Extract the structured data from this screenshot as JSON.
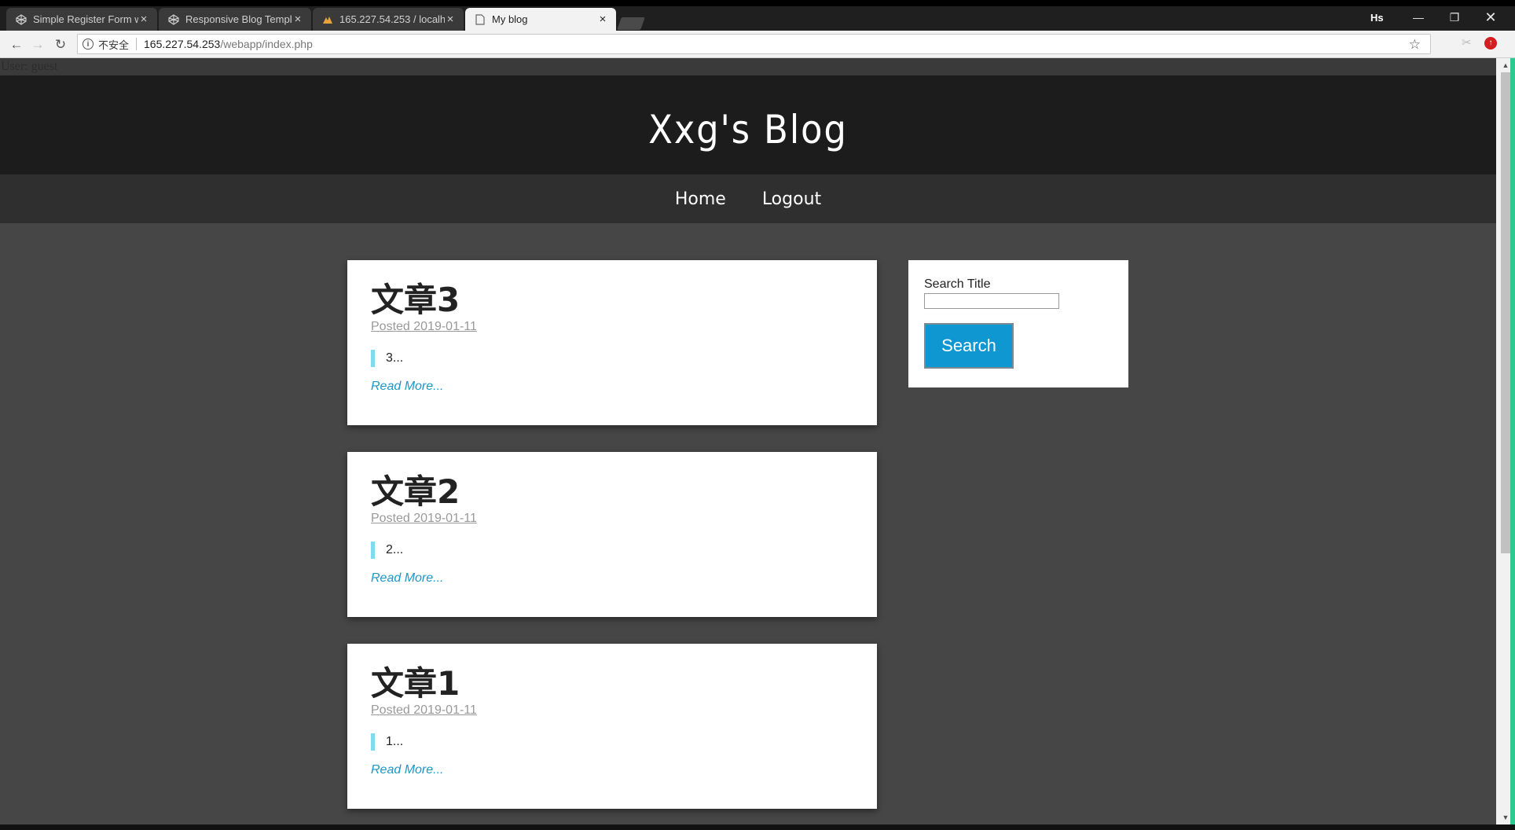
{
  "browser": {
    "tabs": [
      {
        "title": "Simple Register Form w",
        "icon": "codepen-icon"
      },
      {
        "title": "Responsive Blog Templ",
        "icon": "codepen-icon"
      },
      {
        "title": "165.227.54.253 / localh",
        "icon": "phpmyadmin-icon"
      },
      {
        "title": "My blog",
        "icon": "page-icon"
      }
    ],
    "profile": "Hs",
    "address": {
      "security_label": "不安全",
      "host": "165.227.54.253",
      "path": "/webapp/index.php"
    }
  },
  "page": {
    "user_line": "User: guest",
    "blog_title": "Xxg's Blog",
    "nav": [
      "Home",
      "Logout"
    ],
    "posts": [
      {
        "title": "文章3",
        "date": "Posted 2019-01-11",
        "excerpt": "3...",
        "more": "Read More..."
      },
      {
        "title": "文章2",
        "date": "Posted 2019-01-11",
        "excerpt": "2...",
        "more": "Read More..."
      },
      {
        "title": "文章1",
        "date": "Posted 2019-01-11",
        "excerpt": "1...",
        "more": "Read More..."
      }
    ],
    "sidebar": {
      "search_label": "Search Title",
      "search_value": "",
      "search_button": "Search"
    }
  },
  "colors": {
    "accent": "#0e97d1",
    "header_bg": "#1c1c1c",
    "nav_bg": "#2f2f2f",
    "page_bg": "#464646",
    "quote_bar": "#7fdbef"
  }
}
